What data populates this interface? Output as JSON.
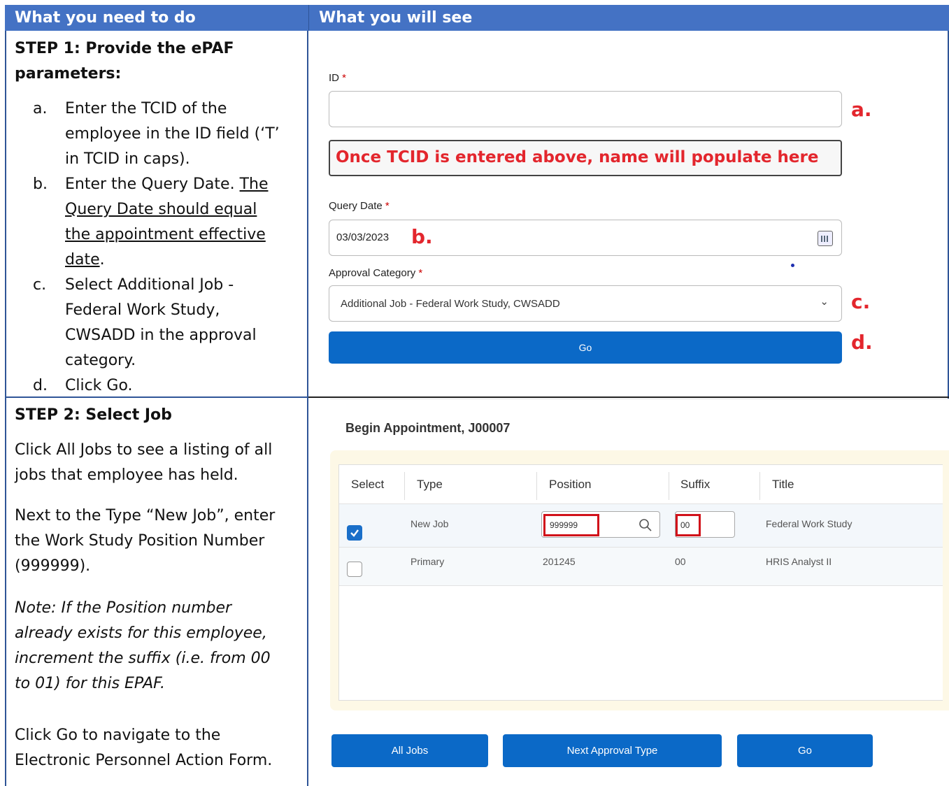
{
  "header": {
    "left": "What you need to do",
    "right": "What you will see"
  },
  "step1": {
    "title_line1": "STEP 1: Provide the ePAF",
    "title_line2": "parameters:",
    "items": [
      {
        "letter": "a.",
        "lines": [
          "Enter the TCID of the",
          "employee in the ID field (‘T’",
          "in TCID in caps)."
        ]
      },
      {
        "letter": "b.",
        "text_plain": "Enter the Query Date. ",
        "text_u1": "The",
        "text_u2": "Query Date should equal",
        "text_u3": "the appointment effective",
        "text_u4": "date",
        "text_end": "."
      },
      {
        "letter": "c.",
        "lines": [
          "Select Additional Job -",
          "Federal Work Study,",
          "CWSADD in the approval",
          "category."
        ]
      },
      {
        "letter": "d.",
        "lines": [
          "Click Go."
        ]
      }
    ]
  },
  "form": {
    "id_label": "ID",
    "req_star": "*",
    "name_hint": "Once TCID is entered above, name will populate here",
    "query_label": "Query Date",
    "query_value": "03/03/2023",
    "approval_label": "Approval Category",
    "approval_value": "Additional Job - Federal Work Study, CWSADD",
    "go_label": "Go",
    "markers": {
      "a": "a.",
      "b": "b.",
      "c": "c.",
      "d": "d."
    }
  },
  "step2": {
    "title": "STEP 2: Select Job",
    "p1": [
      "Click All Jobs to see a listing of all",
      "jobs that employee has held."
    ],
    "p2": [
      "Next to the Type “New Job”, enter",
      "the Work Study Position Number",
      "(999999)."
    ],
    "note": [
      "Note: If the Position number",
      "already exists for this employee,",
      "increment the suffix (i.e. from 00",
      "to 01) for this EPAF."
    ],
    "p3": [
      "Click Go to navigate to the",
      "Electronic Personnel Action Form."
    ]
  },
  "panel": {
    "title": "Begin Appointment, J00007",
    "columns": [
      "Select",
      "Type",
      "Position",
      "Suffix",
      "Title"
    ],
    "rows": [
      {
        "selected": true,
        "type": "New Job",
        "position": "999999",
        "suffix": "00",
        "title": "Federal Work Study"
      },
      {
        "selected": false,
        "type": "Primary",
        "position": "201245",
        "suffix": "00",
        "title": "HRIS Analyst II"
      }
    ],
    "buttons": {
      "all_jobs": "All Jobs",
      "next": "Next Approval Type",
      "go": "Go"
    }
  }
}
